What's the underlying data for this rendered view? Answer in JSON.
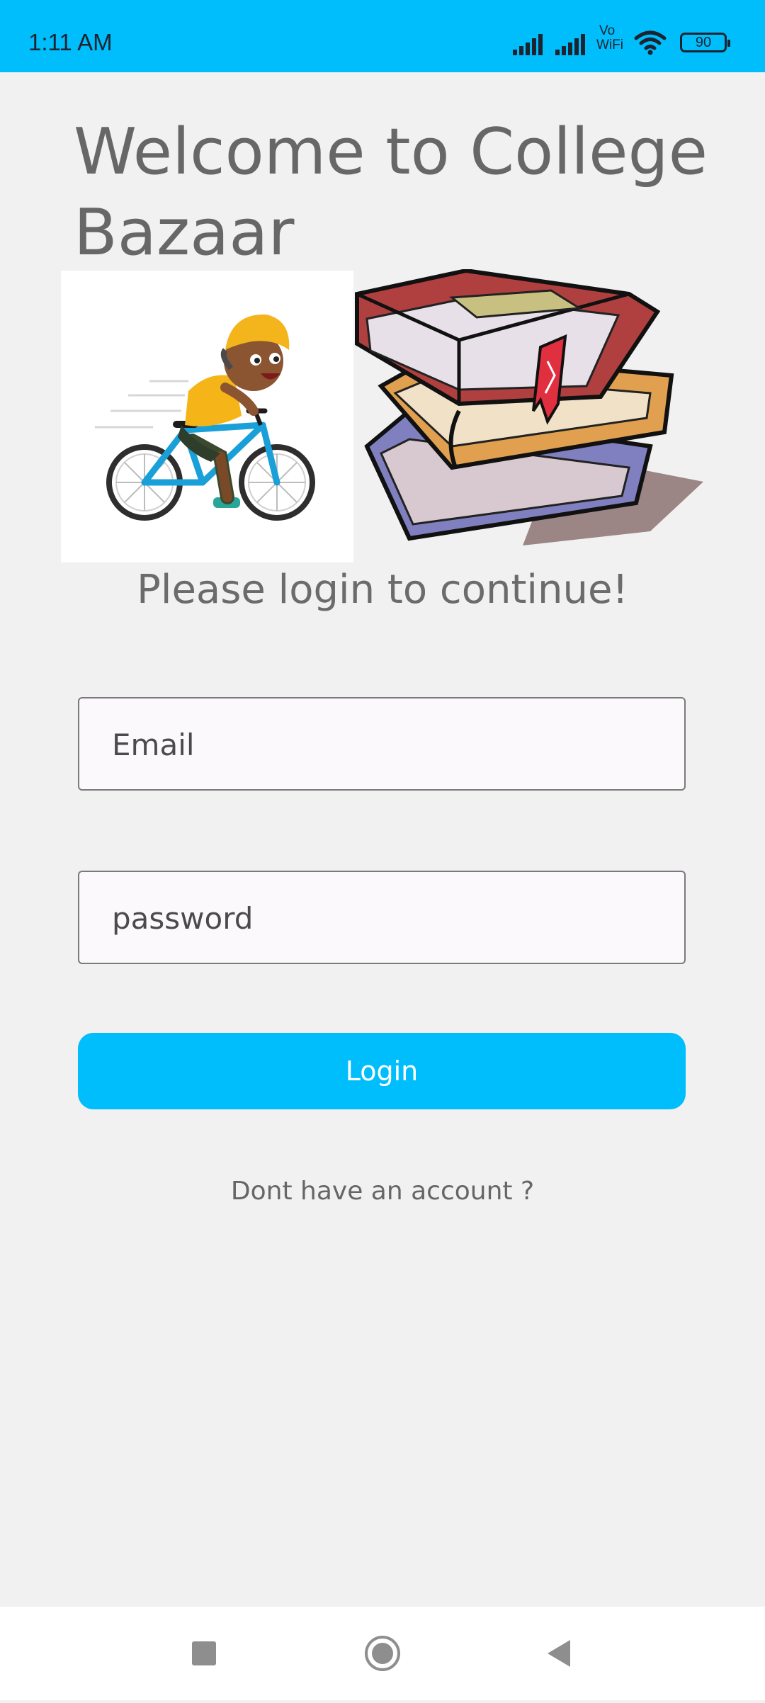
{
  "status_bar": {
    "time": "1:11 AM",
    "vowifi_top": "Vo",
    "vowifi_bottom": "WiFi",
    "battery": "90",
    "background": "#00bdfc",
    "icons": [
      "signal-1-icon",
      "signal-2-icon",
      "vowifi-icon",
      "wifi-icon",
      "battery-icon"
    ]
  },
  "header": {
    "title": "Welcome to College Bazaar"
  },
  "images": {
    "left": "child-on-bicycle-illustration",
    "right": "stack-of-books-illustration"
  },
  "subtitle": "Please login to continue!",
  "form": {
    "email_placeholder": "Email",
    "email_value": "",
    "password_placeholder": "password",
    "password_value": "",
    "login_label": "Login",
    "signup_prompt": "Dont have an account ?"
  },
  "nav_bar": {
    "icons": [
      "recent-apps-icon",
      "home-icon",
      "back-icon"
    ]
  },
  "colors": {
    "accent": "#00bdfc",
    "background": "#f1f1f1",
    "text": "#676767"
  }
}
